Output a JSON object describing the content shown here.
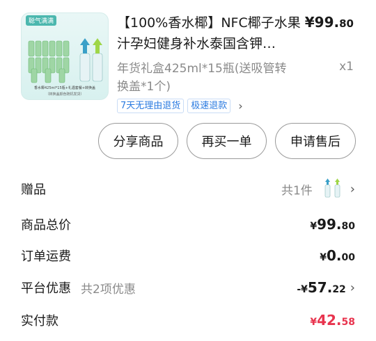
{
  "product": {
    "brand_badge": "聪气满满",
    "image_caption": "香水椰425ml*15瓶+礼遇套餐+转换盖",
    "image_caption2": "（转换盖颜色随机发货）",
    "title": "【100%香水椰】NFC椰子水果汁孕妇健身补水泰国含钾…",
    "price_int": "¥99.",
    "price_dec": "80",
    "spec": "年货礼盒425ml*15瓶(送吸管转换盖*1个)",
    "qty": "x1",
    "tags": [
      "7天无理由退货",
      "极速退款"
    ],
    "tag_arrow": "chevron-right-icon"
  },
  "actions": {
    "share": "分享商品",
    "rebuy": "再买一单",
    "after_sale": "申请售后"
  },
  "summary": {
    "gift_label": "赠品",
    "gift_count": "共1件",
    "goods_total_label": "商品总价",
    "goods_total_sym": "¥",
    "goods_total_int": "99.",
    "goods_total_dec": "80",
    "shipping_label": "订单运费",
    "shipping_sym": "¥",
    "shipping_int": "0.",
    "shipping_dec": "00",
    "discount_label": "平台优惠",
    "discount_sub": "共2项优惠",
    "discount_sym": "-¥",
    "discount_int": "57.",
    "discount_dec": "22",
    "paid_label": "实付款",
    "paid_sym": "¥",
    "paid_int": "42.",
    "paid_dec": "58"
  },
  "colors": {
    "accent_red": "#e8344e",
    "tag_blue": "#2b7be0",
    "thumb_teal": "#4bb7ae"
  }
}
